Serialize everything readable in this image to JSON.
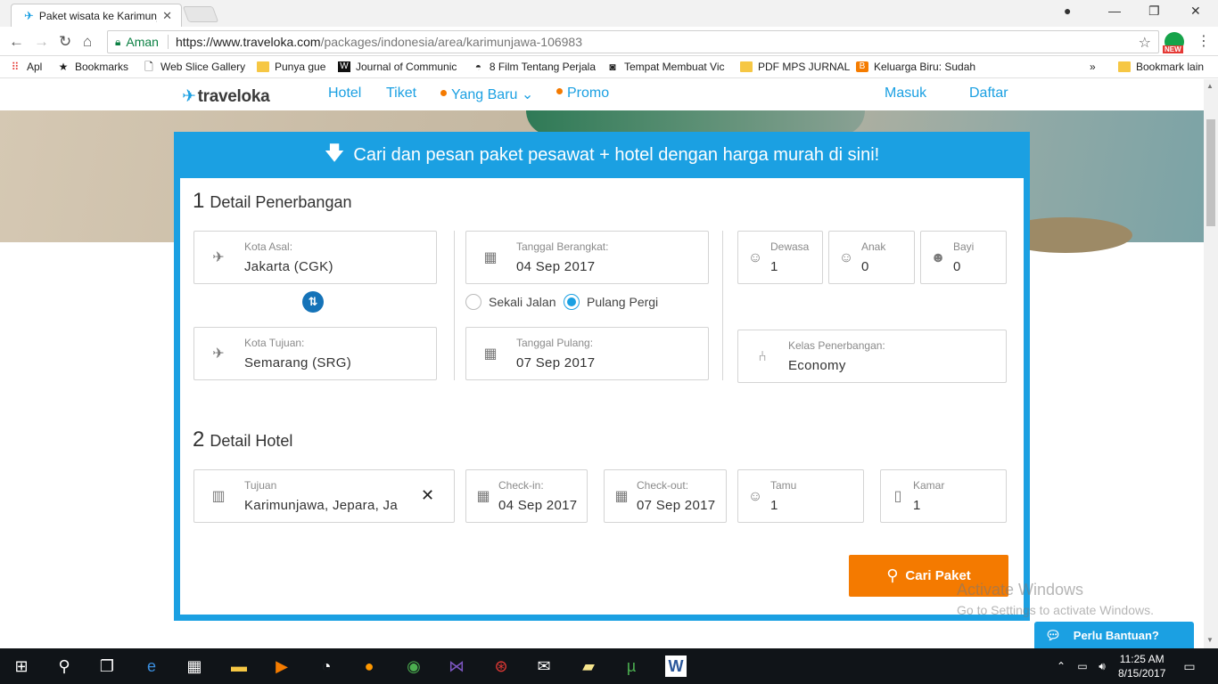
{
  "browser": {
    "tab_title": "Paket wisata ke Karimunjawa",
    "tab_close": "✕",
    "address": {
      "secure_label": "Aman",
      "url_host": "https://www.traveloka.com",
      "url_path": "/packages/indonesia/area/karimunjawa-106983"
    },
    "ext_badge": "NEW",
    "bookmarks": [
      {
        "label": "Apl",
        "icon": "apps-grid"
      },
      {
        "label": "Bookmarks",
        "icon": "star"
      },
      {
        "label": "Web Slice Gallery",
        "icon": "page"
      },
      {
        "label": "Punya gue",
        "icon": "folder"
      },
      {
        "label": "Journal of Communic",
        "icon": "w-logo"
      },
      {
        "label": "8 Film Tentang Perjala",
        "icon": "ninja"
      },
      {
        "label": "Tempat Membuat Vic",
        "icon": "camera"
      },
      {
        "label": "PDF MPS JURNAL",
        "icon": "folder"
      },
      {
        "label": "Keluarga Biru: Sudah",
        "icon": "blogger"
      }
    ],
    "bookmarks_more": "»",
    "other_bookmarks": "Bookmark lain"
  },
  "site": {
    "logo": "traveloka",
    "nav": {
      "hotel": "Hotel",
      "tiket": "Tiket",
      "yang_baru": "Yang Baru",
      "promo": "Promo",
      "masuk": "Masuk",
      "daftar": "Daftar"
    }
  },
  "widget": {
    "headline": "Cari dan pesan paket pesawat + hotel dengan harga murah di sini!",
    "flight": {
      "num": "1",
      "title": "Detail Penerbangan",
      "from_label": "Kota Asal:",
      "from_value": "Jakarta (CGK)",
      "to_label": "Kota Tujuan:",
      "to_value": "Semarang (SRG)",
      "depart_label": "Tanggal Berangkat:",
      "depart_value": "04 Sep 2017",
      "return_label": "Tanggal Pulang:",
      "return_value": "07 Sep 2017",
      "one_way": "Sekali Jalan",
      "round_trip": "Pulang Pergi",
      "trip_selected": "round_trip",
      "adult_label": "Dewasa",
      "adult_value": "1",
      "child_label": "Anak",
      "child_value": "0",
      "infant_label": "Bayi",
      "infant_value": "0",
      "class_label": "Kelas Penerbangan:",
      "class_value": "Economy"
    },
    "hotel": {
      "num": "2",
      "title": "Detail Hotel",
      "dest_label": "Tujuan",
      "dest_value": "Karimunjawa, Jepara, Ja",
      "checkin_label": "Check-in:",
      "checkin_value": "04 Sep 2017",
      "checkout_label": "Check-out:",
      "checkout_value": "07 Sep 2017",
      "guest_label": "Tamu",
      "guest_value": "1",
      "room_label": "Kamar",
      "room_value": "1"
    },
    "search_button": "Cari Paket"
  },
  "overlay": {
    "activate_title": "Activate Windows",
    "activate_sub": "Go to Settings to activate Windows.",
    "help_button": "Perlu Bantuan?"
  },
  "taskbar": {
    "time": "11:25 AM",
    "date": "8/15/2017"
  },
  "colors": {
    "brand_blue": "#1ba0e2",
    "cta_orange": "#f47a00"
  }
}
